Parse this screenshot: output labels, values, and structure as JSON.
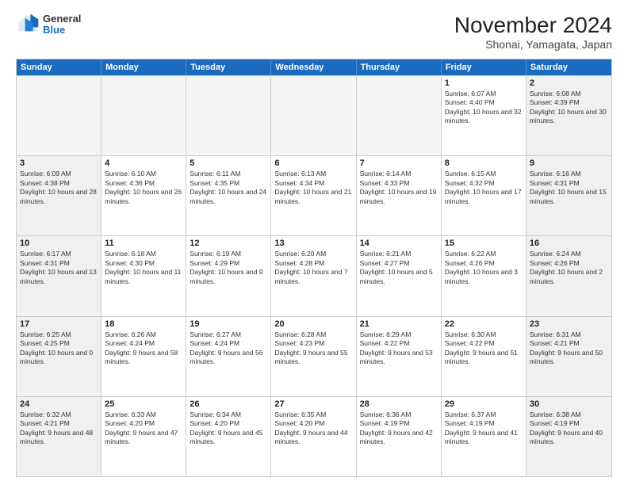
{
  "header": {
    "logo_general": "General",
    "logo_blue": "Blue",
    "title": "November 2024",
    "location": "Shonai, Yamagata, Japan"
  },
  "weekdays": [
    "Sunday",
    "Monday",
    "Tuesday",
    "Wednesday",
    "Thursday",
    "Friday",
    "Saturday"
  ],
  "rows": [
    [
      {
        "day": "",
        "text": "",
        "empty": true
      },
      {
        "day": "",
        "text": "",
        "empty": true
      },
      {
        "day": "",
        "text": "",
        "empty": true
      },
      {
        "day": "",
        "text": "",
        "empty": true
      },
      {
        "day": "",
        "text": "",
        "empty": true
      },
      {
        "day": "1",
        "text": "Sunrise: 6:07 AM\nSunset: 4:40 PM\nDaylight: 10 hours and 32 minutes."
      },
      {
        "day": "2",
        "text": "Sunrise: 6:08 AM\nSunset: 4:39 PM\nDaylight: 10 hours and 30 minutes.",
        "shaded": true
      }
    ],
    [
      {
        "day": "3",
        "text": "Sunrise: 6:09 AM\nSunset: 4:38 PM\nDaylight: 10 hours and 28 minutes.",
        "shaded": true
      },
      {
        "day": "4",
        "text": "Sunrise: 6:10 AM\nSunset: 4:36 PM\nDaylight: 10 hours and 26 minutes."
      },
      {
        "day": "5",
        "text": "Sunrise: 6:11 AM\nSunset: 4:35 PM\nDaylight: 10 hours and 24 minutes."
      },
      {
        "day": "6",
        "text": "Sunrise: 6:13 AM\nSunset: 4:34 PM\nDaylight: 10 hours and 21 minutes."
      },
      {
        "day": "7",
        "text": "Sunrise: 6:14 AM\nSunset: 4:33 PM\nDaylight: 10 hours and 19 minutes."
      },
      {
        "day": "8",
        "text": "Sunrise: 6:15 AM\nSunset: 4:32 PM\nDaylight: 10 hours and 17 minutes."
      },
      {
        "day": "9",
        "text": "Sunrise: 6:16 AM\nSunset: 4:31 PM\nDaylight: 10 hours and 15 minutes.",
        "shaded": true
      }
    ],
    [
      {
        "day": "10",
        "text": "Sunrise: 6:17 AM\nSunset: 4:31 PM\nDaylight: 10 hours and 13 minutes.",
        "shaded": true
      },
      {
        "day": "11",
        "text": "Sunrise: 6:18 AM\nSunset: 4:30 PM\nDaylight: 10 hours and 11 minutes."
      },
      {
        "day": "12",
        "text": "Sunrise: 6:19 AM\nSunset: 4:29 PM\nDaylight: 10 hours and 9 minutes."
      },
      {
        "day": "13",
        "text": "Sunrise: 6:20 AM\nSunset: 4:28 PM\nDaylight: 10 hours and 7 minutes."
      },
      {
        "day": "14",
        "text": "Sunrise: 6:21 AM\nSunset: 4:27 PM\nDaylight: 10 hours and 5 minutes."
      },
      {
        "day": "15",
        "text": "Sunrise: 6:22 AM\nSunset: 4:26 PM\nDaylight: 10 hours and 3 minutes."
      },
      {
        "day": "16",
        "text": "Sunrise: 6:24 AM\nSunset: 4:26 PM\nDaylight: 10 hours and 2 minutes.",
        "shaded": true
      }
    ],
    [
      {
        "day": "17",
        "text": "Sunrise: 6:25 AM\nSunset: 4:25 PM\nDaylight: 10 hours and 0 minutes.",
        "shaded": true
      },
      {
        "day": "18",
        "text": "Sunrise: 6:26 AM\nSunset: 4:24 PM\nDaylight: 9 hours and 58 minutes."
      },
      {
        "day": "19",
        "text": "Sunrise: 6:27 AM\nSunset: 4:24 PM\nDaylight: 9 hours and 56 minutes."
      },
      {
        "day": "20",
        "text": "Sunrise: 6:28 AM\nSunset: 4:23 PM\nDaylight: 9 hours and 55 minutes."
      },
      {
        "day": "21",
        "text": "Sunrise: 6:29 AM\nSunset: 4:22 PM\nDaylight: 9 hours and 53 minutes."
      },
      {
        "day": "22",
        "text": "Sunrise: 6:30 AM\nSunset: 4:22 PM\nDaylight: 9 hours and 51 minutes."
      },
      {
        "day": "23",
        "text": "Sunrise: 6:31 AM\nSunset: 4:21 PM\nDaylight: 9 hours and 50 minutes.",
        "shaded": true
      }
    ],
    [
      {
        "day": "24",
        "text": "Sunrise: 6:32 AM\nSunset: 4:21 PM\nDaylight: 9 hours and 48 minutes.",
        "shaded": true
      },
      {
        "day": "25",
        "text": "Sunrise: 6:33 AM\nSunset: 4:20 PM\nDaylight: 9 hours and 47 minutes."
      },
      {
        "day": "26",
        "text": "Sunrise: 6:34 AM\nSunset: 4:20 PM\nDaylight: 9 hours and 45 minutes."
      },
      {
        "day": "27",
        "text": "Sunrise: 6:35 AM\nSunset: 4:20 PM\nDaylight: 9 hours and 44 minutes."
      },
      {
        "day": "28",
        "text": "Sunrise: 6:36 AM\nSunset: 4:19 PM\nDaylight: 9 hours and 42 minutes."
      },
      {
        "day": "29",
        "text": "Sunrise: 6:37 AM\nSunset: 4:19 PM\nDaylight: 9 hours and 41 minutes."
      },
      {
        "day": "30",
        "text": "Sunrise: 6:38 AM\nSunset: 4:19 PM\nDaylight: 9 hours and 40 minutes.",
        "shaded": true
      }
    ]
  ]
}
